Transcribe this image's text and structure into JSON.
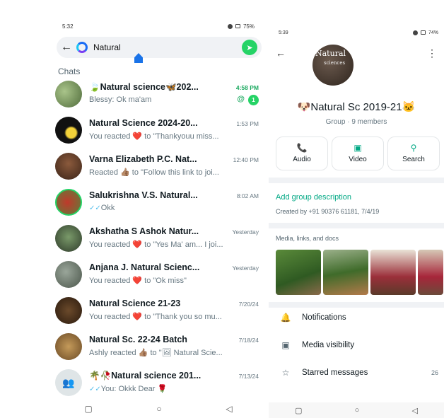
{
  "left": {
    "status": {
      "time": "5:32",
      "battery": "75%"
    },
    "search": {
      "query": "Natural"
    },
    "section_label": "Chats",
    "chats": [
      {
        "name": "🍃Natural science🦋202...",
        "time": "4:58 PM",
        "preview": "Blessy: Ok ma'am",
        "mention": "@",
        "unread": "1"
      },
      {
        "name": "Natural Science 2024-20...",
        "time": "1:53 PM",
        "preview_pre": "You reacted ",
        "emoji": "❤️",
        "preview_post": " to \"Thankyouu miss..."
      },
      {
        "name": "Varna Elizabeth P.C. Nat...",
        "time": "12:40 PM",
        "preview_pre": "Reacted ",
        "emoji": "👍🏽",
        "preview_post": " to \"Follow this link to joi..."
      },
      {
        "name": "Salukrishna V.S. Natural...",
        "time": "8:02 AM",
        "ticks": "✓✓",
        "preview": "Okk"
      },
      {
        "name": "Akshatha S Ashok Natur...",
        "time": "Yesterday",
        "preview_pre": "You reacted ",
        "emoji": "❤️",
        "preview_post": " to \"Yes Ma' am... I joi..."
      },
      {
        "name": "Anjana J. Natural Scienc...",
        "time": "Yesterday",
        "preview_pre": "You reacted ",
        "emoji": "❤️",
        "preview_post": " to \"Ok miss\""
      },
      {
        "name": "Natural Science 21-23",
        "time": "7/20/24",
        "preview_pre": "You reacted ",
        "emoji": "❤️",
        "preview_post": " to \"Thank you so mu..."
      },
      {
        "name": "Natural Sc. 22-24 Batch",
        "time": "7/18/24",
        "preview_pre": "Ashly reacted ",
        "emoji": "👍🏽",
        "preview_post": " to \"🖼 Natural Scie..."
      },
      {
        "name": "🌴🥀Natural science 201...",
        "time": "7/13/24",
        "ticks": "✓✓",
        "preview": "You: Okkk Dear 🌹"
      }
    ]
  },
  "right": {
    "status": {
      "time": "5:39",
      "battery": "74%"
    },
    "avatar_text": {
      "line1": "Natural",
      "line2": "sciences"
    },
    "group_name": "🐶Natural Sc 2019-21🐱",
    "group_sub": "Group · 9 members",
    "actions": [
      {
        "icon": "phone-icon",
        "glyph": "📞",
        "label": "Audio"
      },
      {
        "icon": "video-icon",
        "glyph": "▣",
        "label": "Video"
      },
      {
        "icon": "search-icon",
        "glyph": "⚲",
        "label": "Search"
      }
    ],
    "add_description": "Add group description",
    "created_by": "Created by +91 90376 61181, 7/4/19",
    "media_label": "Media, links, and docs",
    "settings": [
      {
        "icon": "bell-icon",
        "glyph": "🔔",
        "label": "Notifications",
        "count": ""
      },
      {
        "icon": "image-icon",
        "glyph": "▣",
        "label": "Media visibility",
        "count": ""
      },
      {
        "icon": "star-icon",
        "glyph": "☆",
        "label": "Starred messages",
        "count": "26"
      }
    ]
  },
  "colors": {
    "accent": "#00a884",
    "badge": "#25d366",
    "heart": "#e0245e"
  }
}
